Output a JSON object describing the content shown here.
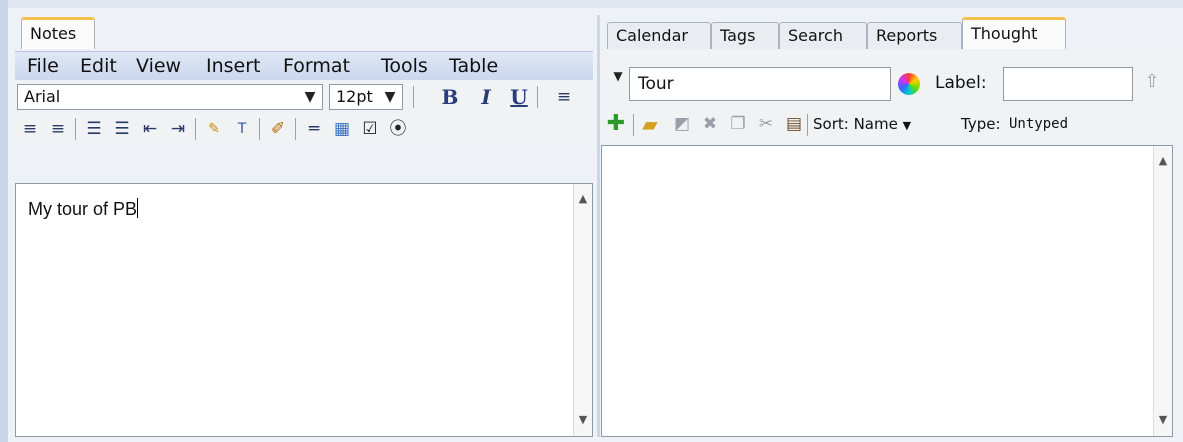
{
  "left": {
    "tab": "Notes",
    "menu": [
      "File",
      "Edit",
      "View",
      "Insert",
      "Format",
      "Tools",
      "Table"
    ],
    "font_family": "Arial",
    "font_size": "12pt",
    "format_buttons": {
      "bold": "B",
      "italic": "I",
      "underline": "U"
    },
    "editor_text": "My tour of PB",
    "checkbox_glyph": "☑",
    "radio_glyph": "⦿"
  },
  "right": {
    "tabs": [
      "Calendar",
      "Tags",
      "Search",
      "Reports",
      "Thought"
    ],
    "active_tab": "Thought",
    "thought_value": "Tour",
    "label_text": "Label:",
    "label_value": "",
    "sort_label": "Sort: Name",
    "type_label": "Type:",
    "type_value": "Untyped"
  },
  "icons": [
    "dropdown-arrow-icon",
    "align-left-icon",
    "align-center-icon",
    "align-justify-icon",
    "bullet-list-icon",
    "numbered-list-icon",
    "outdent-icon",
    "indent-icon",
    "spellcheck-icon",
    "text-color-icon",
    "highlighter-icon",
    "horizontal-rule-icon",
    "table-icon",
    "checkbox-icon",
    "radio-icon",
    "color-wheel-icon",
    "go-up-icon",
    "add-child-icon",
    "open-folder-icon",
    "move-icon",
    "delete-icon",
    "copy-icon",
    "cut-icon",
    "paste-icon",
    "scroll-up-icon",
    "scroll-down-icon"
  ],
  "colors": {
    "active_tab_accent": "#f2c24c",
    "menubar_top": "#dfe7f5",
    "menubar_bottom": "#cbd7ee",
    "background": "#eef1f6"
  }
}
